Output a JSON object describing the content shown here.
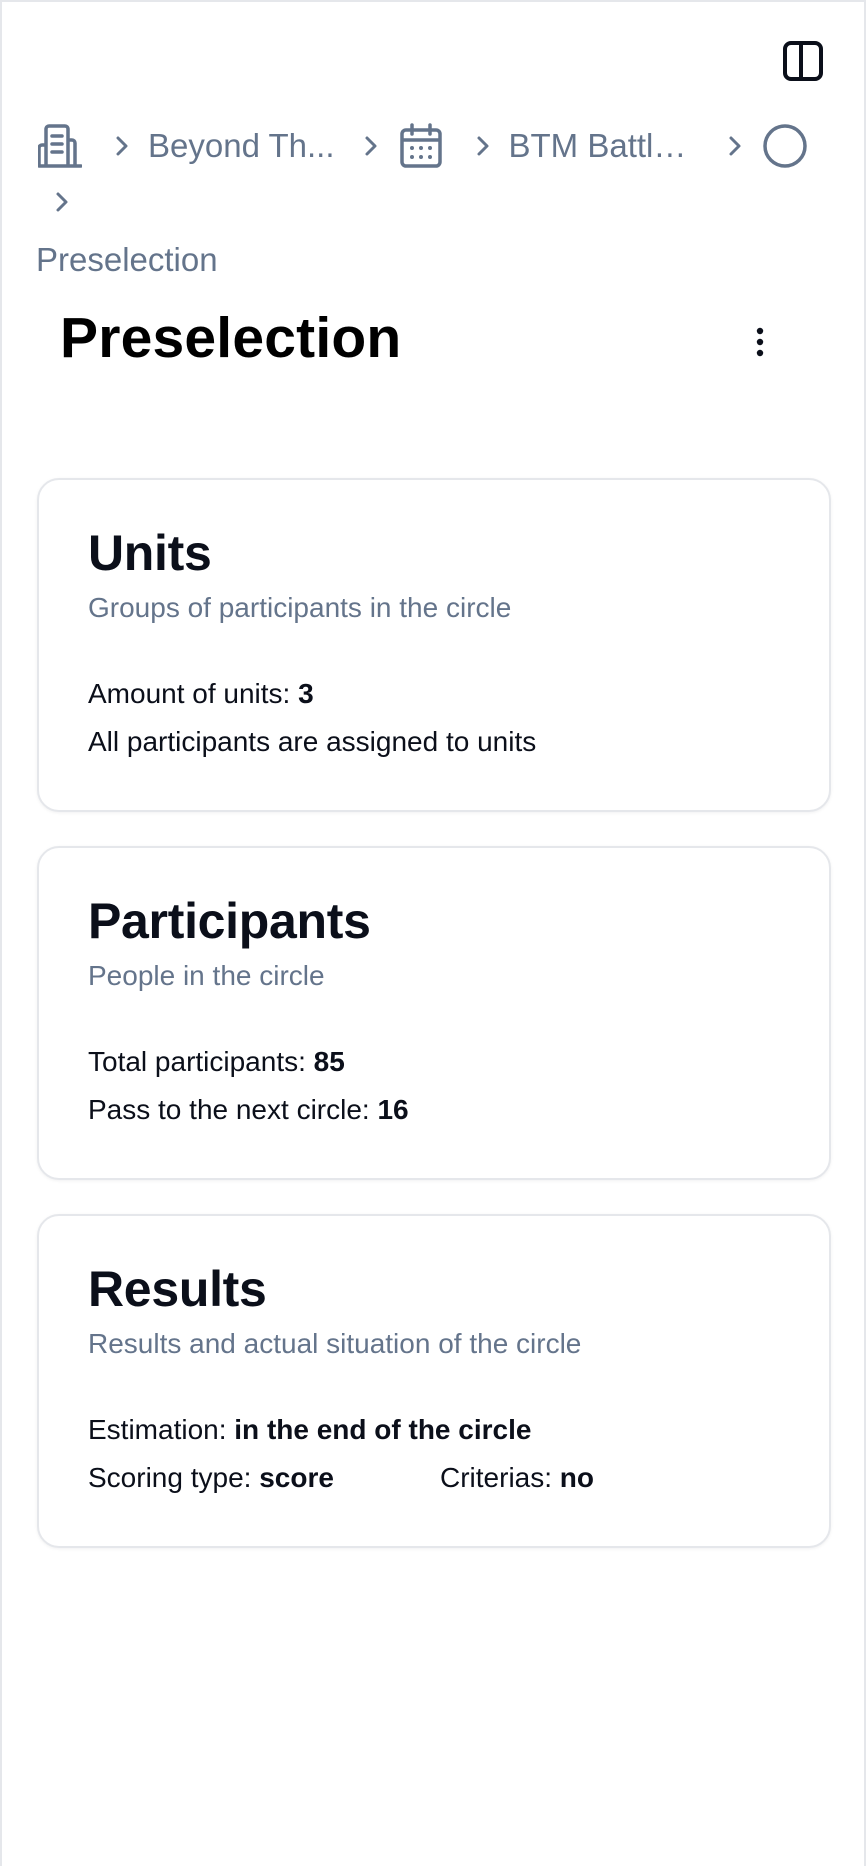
{
  "breadcrumb": {
    "items": [
      {
        "icon": "building-icon",
        "label": "Beyond Th..."
      },
      {
        "icon": "calendar-icon",
        "label": "BTM Battle..."
      },
      {
        "icon": "circle-icon",
        "label": ""
      }
    ],
    "current": "Preselection"
  },
  "page": {
    "title": "Preselection"
  },
  "cards": {
    "units": {
      "title": "Units",
      "subtitle": "Groups of participants in the circle",
      "amount_label": "Amount of units:",
      "amount_value": "3",
      "status": "All participants are assigned to units"
    },
    "participants": {
      "title": "Participants",
      "subtitle": "People in the circle",
      "total_label": "Total participants:",
      "total_value": "85",
      "pass_label": "Pass to the next circle:",
      "pass_value": "16"
    },
    "results": {
      "title": "Results",
      "subtitle": "Results and actual situation of the circle",
      "estimation_label": "Estimation:",
      "estimation_value": "in the end of the circle",
      "scoring_label": "Scoring type:",
      "scoring_value": "score",
      "criterias_label": "Criterias:",
      "criterias_value": "no"
    }
  },
  "colors": {
    "text_primary": "#0b0f1a",
    "text_muted": "#64748b",
    "border": "#e5e7eb",
    "background": "#ffffff"
  }
}
